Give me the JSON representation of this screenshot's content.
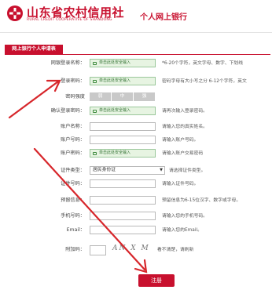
{
  "header": {
    "bank_name": "山东省农村信用社",
    "bank_subtitle": "RURAL CREDIT COOPERATIVE OF SHANDONG",
    "product": "个人网上银行"
  },
  "form": {
    "tab_label": "网上银行个人申请表",
    "keyboard_text": "单击此处安全输入",
    "rows": {
      "login_name": {
        "label": "网银登录名称：",
        "hint": "*6-20个字符，英文字母、数字、下划线"
      },
      "login_pwd": {
        "label": "登录密码：",
        "hint": "密码字母有大小写之分 6-12个字符，英文"
      },
      "pwd_strength": {
        "label": "密码强度",
        "levels": [
          "弱",
          "中",
          "强"
        ]
      },
      "confirm_pwd": {
        "label": "确认登录密码：",
        "hint": "请再次输入登录密码。"
      },
      "account_name": {
        "label": "账户名称：",
        "hint": "请输入您的真实姓名。"
      },
      "account_no": {
        "label": "账户号码：",
        "hint": "请输入账户号码。"
      },
      "account_pwd": {
        "label": "账户密码：",
        "hint": "请输入账户交易密码"
      },
      "id_type": {
        "label": "证件类型：",
        "value": "居民身份证",
        "hint": "请选择证件类型。"
      },
      "id_no": {
        "label": "证件号码：",
        "hint": "请输入证件号码。"
      },
      "reserved_info": {
        "label": "预留信息：",
        "hint": "预留信息为6-15位汉字、数字或字母。"
      },
      "mobile": {
        "label": "手机号码：",
        "hint": "请输入您的手机号码。"
      },
      "email": {
        "label": "Email：",
        "hint": "请输入您的Email。"
      },
      "captcha": {
        "label": "附加码：",
        "image_text": "AN X M",
        "hint": "看不清楚，请刷新"
      }
    },
    "submit_label": "注册"
  },
  "colors": {
    "brand_red": "#c8102e",
    "keyboard_green": "#e7f4e2",
    "annotation_arrow": "#d7262b"
  },
  "icons": [
    "rcc-logo-icon",
    "keyboard-icon",
    "select-caret-icon",
    "annotation-arrow"
  ]
}
